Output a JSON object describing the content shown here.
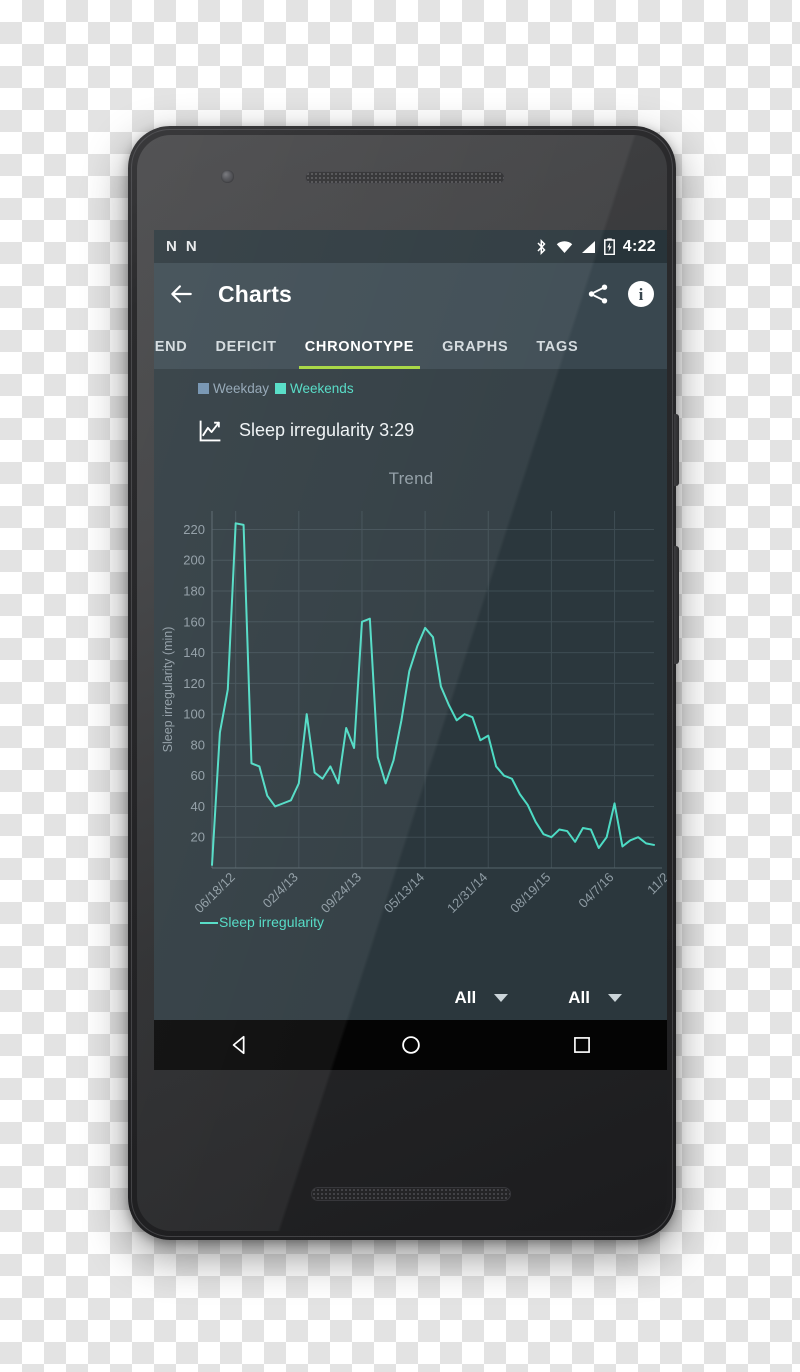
{
  "device": {
    "type": "android-smartphone",
    "camera_icon": "front-camera",
    "earpiece_icon": "earpiece-speaker",
    "bottom_speaker_icon": "bottom-speaker"
  },
  "status_bar": {
    "left_glyphs": [
      "N",
      "N"
    ],
    "icons": [
      "bluetooth-icon",
      "wifi-icon",
      "signal-icon",
      "battery-charging-icon"
    ],
    "time": "4:22"
  },
  "app_bar": {
    "back_icon": "back-arrow-icon",
    "title": "Charts",
    "share_icon": "share-icon",
    "info_icon": "info-icon"
  },
  "tabs": [
    {
      "label": "TREND",
      "active": false
    },
    {
      "label": "DEFICIT",
      "active": false
    },
    {
      "label": "CHRONOTYPE",
      "active": true
    },
    {
      "label": "GRAPHS",
      "active": false
    },
    {
      "label": "TAGS",
      "active": false
    }
  ],
  "active_tab_indicator_color": "#a4d53a",
  "chip_legend": [
    {
      "label": "Weekday",
      "color": "#6f8fae"
    },
    {
      "label": "Weekends",
      "color": "#4ddbc4"
    }
  ],
  "metric": {
    "icon": "line-chart-icon",
    "label": "Sleep irregularity 3:29"
  },
  "selectors": [
    {
      "value": "All"
    },
    {
      "value": "All"
    }
  ],
  "nav_bar": {
    "back": "nav-back-icon",
    "home": "nav-home-icon",
    "recents": "nav-recents-icon"
  },
  "chart_data": {
    "type": "line",
    "title": "Trend",
    "xlabel": "",
    "ylabel": "Sleep irregularity (min)",
    "line_color": "#4ddbc4",
    "grid": true,
    "legend_position": "bottom-left",
    "ylim": [
      0,
      232
    ],
    "yticks": [
      20,
      40,
      60,
      80,
      100,
      120,
      140,
      160,
      180,
      200,
      220
    ],
    "xtick_labels": [
      "06/18/12",
      "02/4/13",
      "09/24/13",
      "05/13/14",
      "12/31/14",
      "08/19/15",
      "04/7/16",
      "11/2"
    ],
    "xtick_positions": [
      3,
      11,
      19,
      27,
      35,
      43,
      51,
      58
    ],
    "series": [
      {
        "name": "Sleep irregularity",
        "values": [
          2,
          88,
          116,
          224,
          223,
          68,
          66,
          47,
          40,
          42,
          44,
          55,
          100,
          62,
          58,
          66,
          55,
          91,
          78,
          160,
          162,
          72,
          55,
          70,
          96,
          128,
          144,
          156,
          150,
          118,
          106,
          96,
          100,
          98,
          83,
          86,
          66,
          60,
          58,
          48,
          41,
          30,
          22,
          20,
          25,
          24,
          17,
          26,
          25,
          13,
          20,
          42,
          14,
          18,
          20,
          16,
          15
        ]
      }
    ]
  }
}
